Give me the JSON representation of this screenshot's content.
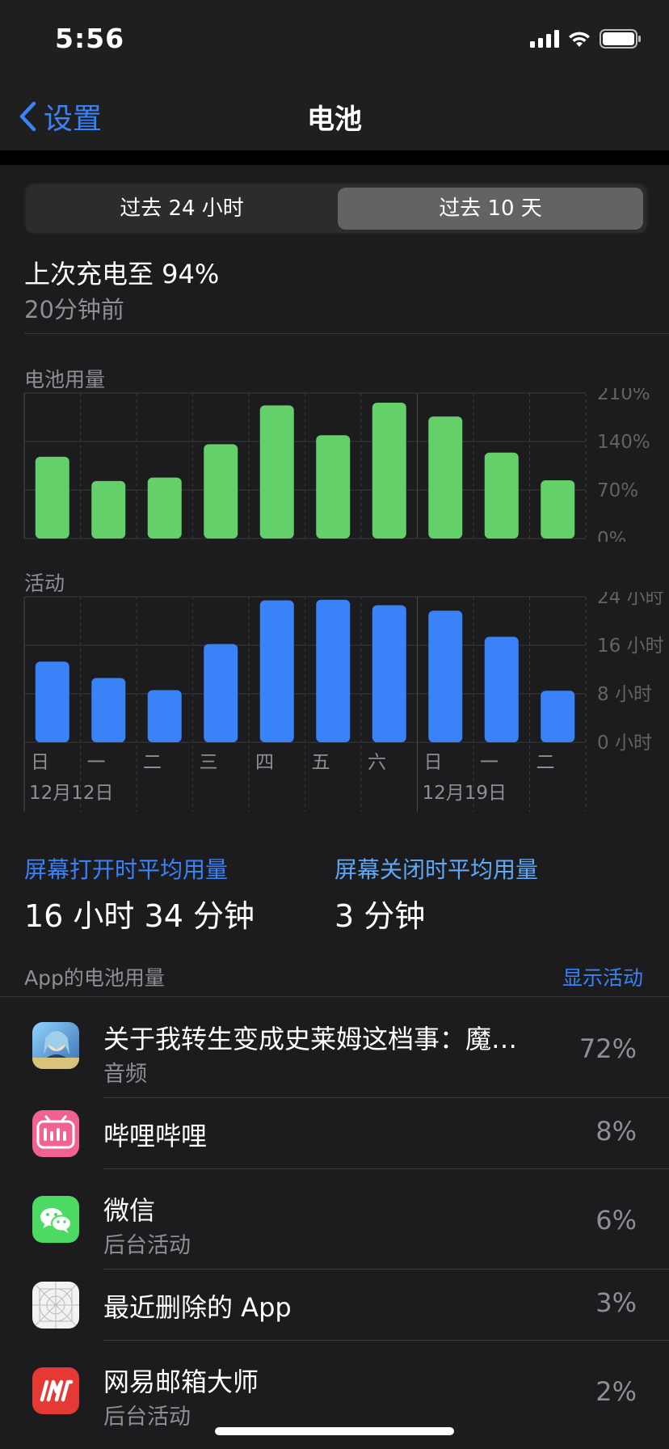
{
  "status_bar": {
    "time": "5:56"
  },
  "nav": {
    "back_label": "设置",
    "title": "电池"
  },
  "segments": {
    "left": "过去 24 小时",
    "right": "过去 10 天",
    "selected": "right"
  },
  "last_charge": {
    "title": "上次充电至 94%",
    "subtitle": "20分钟前"
  },
  "battery_chart": {
    "title": "电池用量",
    "ticks": [
      "210%",
      "140%",
      "70%",
      "0%"
    ]
  },
  "activity_chart": {
    "title": "活动",
    "ticks": [
      "24 小时",
      "16 小时",
      "8 小时",
      "0 小时"
    ],
    "days": [
      "日",
      "一",
      "二",
      "三",
      "四",
      "五",
      "六",
      "日",
      "一",
      "二"
    ],
    "week_labels": [
      "12月12日",
      "12月19日"
    ]
  },
  "chart_data": [
    {
      "type": "bar",
      "title": "电池用量",
      "categories": [
        "日",
        "一",
        "二",
        "三",
        "四",
        "五",
        "六",
        "日",
        "一",
        "二"
      ],
      "values": [
        118,
        83,
        88,
        136,
        192,
        149,
        196,
        176,
        124,
        84
      ],
      "ylim": [
        0,
        210
      ],
      "unit": "%",
      "color": "#64d06a"
    },
    {
      "type": "bar",
      "title": "活动",
      "categories": [
        "日",
        "一",
        "二",
        "三",
        "四",
        "五",
        "六",
        "日",
        "一",
        "二"
      ],
      "values": [
        13.3,
        10.6,
        8.6,
        16.2,
        23.4,
        23.5,
        22.6,
        21.7,
        17.4,
        8.5
      ],
      "ylim": [
        0,
        24
      ],
      "unit": "小时",
      "color": "#3a82f7"
    }
  ],
  "screen_usage": {
    "on_label": "屏幕打开时平均用量",
    "on_value": "16 小时 34 分钟",
    "off_label": "屏幕关闭时平均用量",
    "off_value": "3 分钟"
  },
  "apps_section": {
    "title": "App的电池用量",
    "toggle": "显示活动"
  },
  "apps": [
    {
      "name": "关于我转生变成史莱姆这档事：魔…",
      "sub": "音频",
      "percent": "72%",
      "icon": "anime-game-icon"
    },
    {
      "name": "哔哩哔哩",
      "sub": "",
      "percent": "8%",
      "icon": "bilibili-icon"
    },
    {
      "name": "微信",
      "sub": "后台活动",
      "percent": "6%",
      "icon": "wechat-icon"
    },
    {
      "name": "最近删除的 App",
      "sub": "",
      "percent": "3%",
      "icon": "deleted-app-icon"
    },
    {
      "name": "网易邮箱大师",
      "sub": "后台活动",
      "percent": "2%",
      "icon": "netease-mail-icon"
    }
  ],
  "colors": {
    "accent": "#3a82f7",
    "battery_bar": "#64d06a",
    "activity_bar": "#3a82f7",
    "background": "#1c1c1e"
  }
}
